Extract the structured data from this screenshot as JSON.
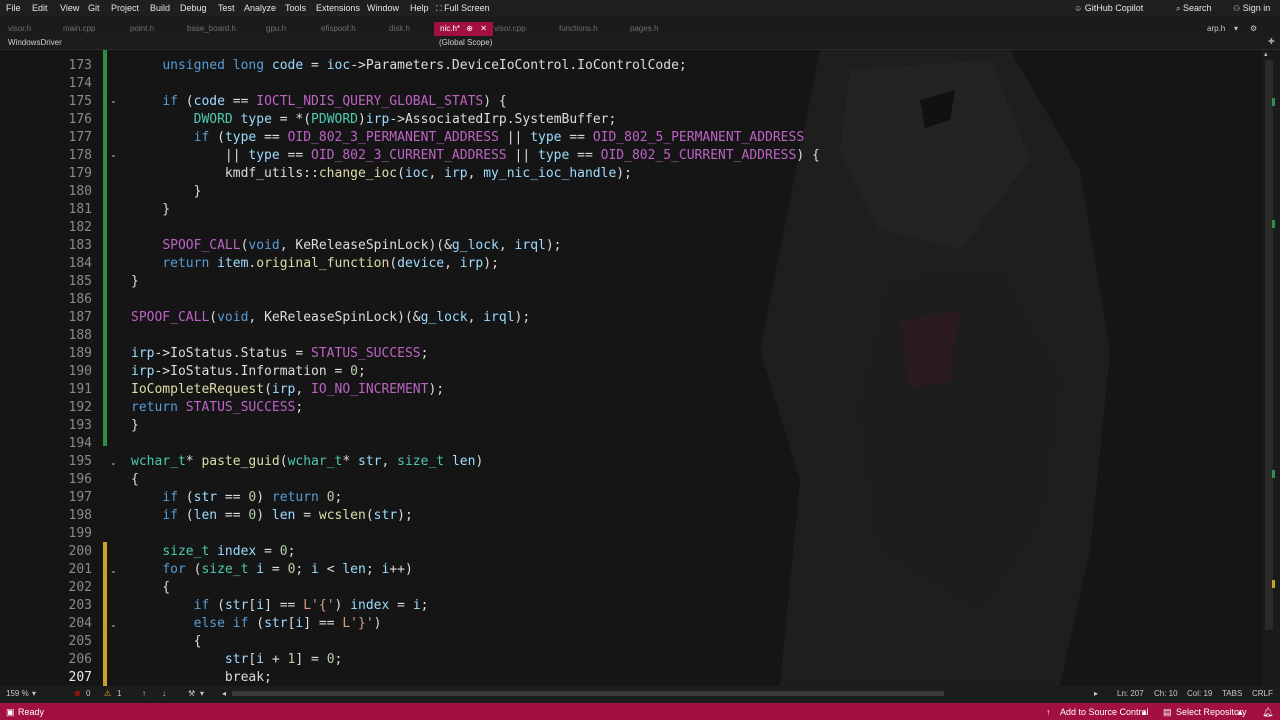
{
  "menu": [
    "File",
    "Edit",
    "View",
    "Git",
    "Project",
    "Build",
    "Debug",
    "Test",
    "Analyze",
    "Tools",
    "Extensions",
    "Window",
    "Help"
  ],
  "fullscreen_label": "Full Screen",
  "copilot_label": "GitHub Copilot",
  "search_label": "Search",
  "signin_label": "Sign in",
  "tabs": [
    {
      "label": "visor.h"
    },
    {
      "label": "main.cpp"
    },
    {
      "label": "point.h"
    },
    {
      "label": "base_board.h"
    },
    {
      "label": "gpu.h"
    },
    {
      "label": "efispoof.h"
    },
    {
      "label": "disk.h"
    },
    {
      "label": "nic.h*"
    },
    {
      "label": "visor.cpp"
    },
    {
      "label": "functions.h"
    },
    {
      "label": "pages.h"
    }
  ],
  "pinned_tab": "arp.h",
  "active_tab_pin": "⊕",
  "active_tab_close": "✕",
  "project_selector": "WindowsDriver",
  "scope_selector": "(Global Scope)",
  "code_lines": [
    {
      "n": "173",
      "t": "    unsigned long code = ioc->Parameters.DeviceIoControl.IoControlCode;"
    },
    {
      "n": "174",
      "t": ""
    },
    {
      "n": "175",
      "t": "    if (code == IOCTL_NDIS_QUERY_GLOBAL_STATS) {"
    },
    {
      "n": "176",
      "t": "        DWORD type = *(PDWORD)irp->AssociatedIrp.SystemBuffer;"
    },
    {
      "n": "177",
      "t": "        if (type == OID_802_3_PERMANENT_ADDRESS || type == OID_802_5_PERMANENT_ADDRESS"
    },
    {
      "n": "178",
      "t": "            || type == OID_802_3_CURRENT_ADDRESS || type == OID_802_5_CURRENT_ADDRESS) {"
    },
    {
      "n": "179",
      "t": "            kmdf_utils::change_ioc(ioc, irp, my_nic_ioc_handle);"
    },
    {
      "n": "180",
      "t": "        }"
    },
    {
      "n": "181",
      "t": "    }"
    },
    {
      "n": "182",
      "t": ""
    },
    {
      "n": "183",
      "t": "    SPOOF_CALL(void, KeReleaseSpinLock)(&g_lock, irql);"
    },
    {
      "n": "184",
      "t": "    return item.original_function(device, irp);"
    },
    {
      "n": "185",
      "t": "}"
    },
    {
      "n": "186",
      "t": ""
    },
    {
      "n": "187",
      "t": "SPOOF_CALL(void, KeReleaseSpinLock)(&g_lock, irql);"
    },
    {
      "n": "188",
      "t": ""
    },
    {
      "n": "189",
      "t": "irp->IoStatus.Status = STATUS_SUCCESS;"
    },
    {
      "n": "190",
      "t": "irp->IoStatus.Information = 0;"
    },
    {
      "n": "191",
      "t": "IoCompleteRequest(irp, IO_NO_INCREMENT);"
    },
    {
      "n": "192",
      "t": "return STATUS_SUCCESS;"
    },
    {
      "n": "193",
      "t": "}"
    },
    {
      "n": "194",
      "t": ""
    },
    {
      "n": "195",
      "t": "wchar_t* paste_guid(wchar_t* str, size_t len)"
    },
    {
      "n": "196",
      "t": "{"
    },
    {
      "n": "197",
      "t": "    if (str == 0) return 0;"
    },
    {
      "n": "198",
      "t": "    if (len == 0) len = wcslen(str);"
    },
    {
      "n": "199",
      "t": ""
    },
    {
      "n": "200",
      "t": "    size_t index = 0;"
    },
    {
      "n": "201",
      "t": "    for (size_t i = 0; i < len; i++)"
    },
    {
      "n": "202",
      "t": "    {"
    },
    {
      "n": "203",
      "t": "        if (str[i] == L'{') index = i;"
    },
    {
      "n": "204",
      "t": "        else if (str[i] == L'}')"
    },
    {
      "n": "205",
      "t": "        {"
    },
    {
      "n": "206",
      "t": "            str[i + 1] = 0;"
    },
    {
      "n": "207",
      "t": "            break;"
    }
  ],
  "info": {
    "zoom": "159 %",
    "errors": "0",
    "warnings": "1",
    "ln": "Ln: 207",
    "ch": "Ch: 10",
    "col": "Col: 19",
    "tabs": "TABS",
    "eol": "CRLF"
  },
  "status": {
    "ready": "Ready",
    "add_source": "Add to Source Control",
    "select_repo": "Select Repository"
  },
  "colors": {
    "accent": "#a1103e",
    "keyword": "#569cd6",
    "type": "#4ec9b0",
    "function": "#dcdcaa",
    "macro": "#bd63c5",
    "number": "#b5cea8",
    "string": "#d69d85",
    "variable": "#9cdcfe",
    "gutter_changed": "#2f8f46",
    "gutter_unsaved": "#c9a227"
  }
}
